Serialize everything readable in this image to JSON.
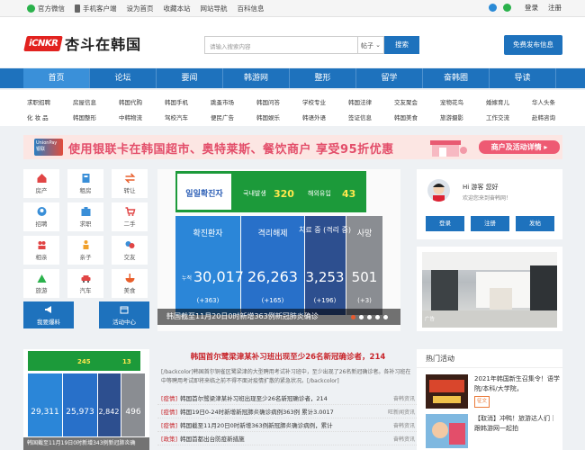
{
  "topbar": {
    "wechat": "官方微信",
    "mobile": "手机客户端",
    "home": "设为首页",
    "fav": "收藏本站",
    "site_nav": "网站导航",
    "wiki": "百科信息",
    "login": "登录",
    "register": "注册"
  },
  "logo": {
    "badge": "iCNKR",
    "name": "杏斗在韩国"
  },
  "search": {
    "placeholder": "请输入搜索内容",
    "select": "帖子",
    "button": "搜索"
  },
  "free_post": "免费发布信息",
  "nav": [
    "首页",
    "论坛",
    "要闻",
    "韩游网",
    "整形",
    "留学",
    "奋韩圈",
    "导读"
  ],
  "subnav": {
    "row1": [
      "求职招聘",
      "房屋信息",
      "韩国代购",
      "韩国手机",
      "跳蚤市场",
      "韩国问答",
      "学校专业",
      "韩国法律",
      "交友聚会",
      "宠物花鸟",
      "婚嫁育儿",
      "华人头条"
    ],
    "row2": [
      "化 妆 品",
      "韩国整形",
      "中韩物流",
      "驾校汽车",
      "便民广告",
      "韩国娱乐",
      "韩语外语",
      "签证信息",
      "韩国美食",
      "旅游摄影",
      "工作交流",
      "赴韩咨询"
    ]
  },
  "banner": {
    "card": "UnionPay 银联",
    "text": "使用银联卡在韩国超市、奥特莱斯、餐饮商户 享受95折优惠",
    "action": "商户及活动详情 ▸"
  },
  "categories": [
    {
      "label": "房产"
    },
    {
      "label": "租房"
    },
    {
      "label": "转让"
    },
    {
      "label": "招聘"
    },
    {
      "label": "求职"
    },
    {
      "label": "二手"
    },
    {
      "label": "相亲"
    },
    {
      "label": "亲子"
    },
    {
      "label": "交友"
    },
    {
      "label": "旅游"
    },
    {
      "label": "汽车"
    },
    {
      "label": "美食"
    }
  ],
  "actions": {
    "report": "我要爆料",
    "center": "活动中心"
  },
  "slider": {
    "stats": {
      "title": "일일확진자",
      "domestic_label": "국내발생",
      "domestic": "320",
      "import_label": "해외유입",
      "imported": "43",
      "confirmed_label": "확진환자",
      "confirmed": "30,017",
      "confirmed_delta": "(+363)",
      "confirmed_prefix": "누적",
      "released_label": "격리해제",
      "released": "26,263",
      "released_delta": "(+165)",
      "treat_label": "치료 중\n(격리 중)",
      "treat": "3,253",
      "treat_delta": "(+196)",
      "death_label": "사망",
      "death": "501",
      "death_delta": "(+3)"
    },
    "caption": "韩国截至11月20日0时新增363例新冠肺炎确诊"
  },
  "user": {
    "hi": "Hi 游客 您好",
    "welcome": "欢迎您来到奋韩网！",
    "login": "登录",
    "register": "注册",
    "post": "发帖"
  },
  "ad": {
    "tag": "广告"
  },
  "left_news": {
    "stats": {
      "domestic": "245",
      "imported": "13",
      "confirmed": "29,311",
      "released": "25,973",
      "treat": "2,842",
      "death": "496"
    },
    "caption": "韩国截至11月19日0时新增343例新冠肺炎确"
  },
  "news": {
    "headline": "韩国首尔鹭梁津某补习班出现至少26名新冠确诊者，214",
    "desc": "[/backcolor]韩国首尔铜雀区鹭梁津的大型聘用考试补习班中，至少出现了26名新冠确诊者。各补习班在中等聘用考试即将来临之前不得不面对疫情扩散的紧急状况。[/backcolor]",
    "items": [
      {
        "tag": "[疫情]",
        "title": "韩国首尔鹭梁津某补习班出现至少26名新冠确诊者，214",
        "src": "奋韩资讯"
      },
      {
        "tag": "[疫情]",
        "title": "韩国19日0-24时新增新冠肺炎确诊病例363例 累计3.0017",
        "src": "旺新闻资讯"
      },
      {
        "tag": "[疫情]",
        "title": "韩国截至11月20日0时新增363例新冠肺炎确诊病例，累计",
        "src": "奋韩资讯"
      },
      {
        "tag": "[政策]",
        "title": "韩国首都出台防疫新措施",
        "src": "奋韩资讯"
      }
    ]
  },
  "hot": {
    "title": "热门活动",
    "items": [
      {
        "text": "2021年韩国新生召集令！语学院/本科/大学院，",
        "tag": "征文"
      },
      {
        "text": "【取消】冲鸭！旅游达人们｜跟韩游网一起拍",
        "tag": ""
      }
    ]
  }
}
